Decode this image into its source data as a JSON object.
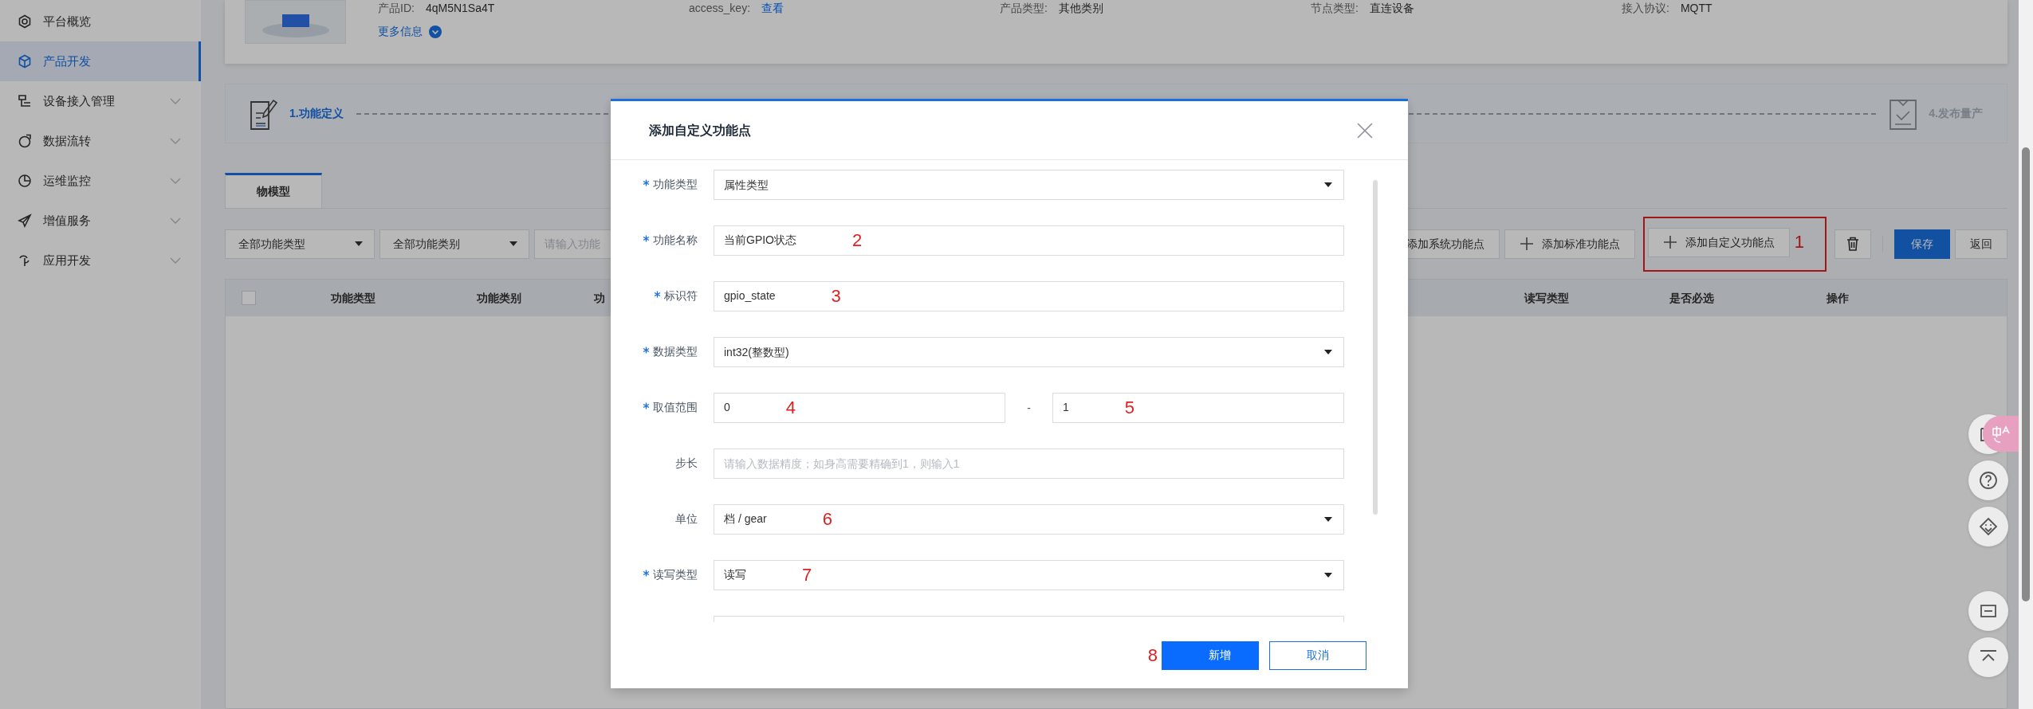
{
  "sidebar": {
    "items": [
      {
        "label": "平台概览",
        "selected": false,
        "expandable": false
      },
      {
        "label": "产品开发",
        "selected": true,
        "expandable": false
      },
      {
        "label": "设备接入管理",
        "selected": false,
        "expandable": true
      },
      {
        "label": "数据流转",
        "selected": false,
        "expandable": true
      },
      {
        "label": "运维监控",
        "selected": false,
        "expandable": true
      },
      {
        "label": "增值服务",
        "selected": false,
        "expandable": true
      },
      {
        "label": "应用开发",
        "selected": false,
        "expandable": true
      }
    ]
  },
  "product": {
    "info": [
      {
        "label": "产品ID:",
        "value": "4qM5N1Sa4T",
        "kind": "text"
      },
      {
        "label": "access_key:",
        "value": "查看",
        "kind": "link"
      },
      {
        "label": "产品类型:",
        "value": "其他类别",
        "kind": "text"
      },
      {
        "label": "节点类型:",
        "value": "直连设备",
        "kind": "text"
      },
      {
        "label": "接入协议:",
        "value": "MQTT",
        "kind": "text"
      }
    ],
    "more_link": "更多信息"
  },
  "steps": [
    {
      "label": "1.功能定义",
      "active": true
    },
    {
      "label": "4.发布量产",
      "active": false
    }
  ],
  "tabs": [
    {
      "label": "物模型",
      "selected": true
    }
  ],
  "toolbar": {
    "filters": [
      {
        "value": "全部功能类型"
      },
      {
        "value": "全部功能类别"
      }
    ],
    "search": {
      "placeholder": "请输入功能"
    },
    "buttons": [
      {
        "label": "添加系统功能点",
        "kind": "text",
        "highlighted": false
      },
      {
        "label": "添加标准功能点",
        "kind": "add",
        "highlighted": false
      },
      {
        "label": "添加自定义功能点",
        "kind": "add",
        "highlighted": true,
        "annotation": "1"
      },
      {
        "kind": "delete",
        "highlighted": false
      },
      {
        "label": "保存",
        "kind": "primary",
        "highlighted": false
      },
      {
        "label": "返回",
        "kind": "default",
        "highlighted": false
      }
    ]
  },
  "table": {
    "header_checkbox": {
      "checked": false
    },
    "columns": [
      "功能类型",
      "功能类别",
      "功",
      "读写类型",
      "是否必选",
      "操作"
    ]
  },
  "modal": {
    "title": "添加自定义功能点",
    "fields": [
      {
        "label": "功能类型",
        "required": true,
        "kind": "select",
        "value": "属性类型"
      },
      {
        "label": "功能名称",
        "required": true,
        "kind": "input",
        "value": "当前GPIO状态",
        "annotation": "2"
      },
      {
        "label": "标识符",
        "required": true,
        "kind": "input",
        "value": "gpio_state",
        "annotation": "3"
      },
      {
        "label": "数据类型",
        "required": true,
        "kind": "select",
        "value": "int32(整数型)"
      },
      {
        "label": "取值范围",
        "required": true,
        "kind": "range",
        "min": "0",
        "min_annotation": "4",
        "separator": "-",
        "max": "1",
        "max_annotation": "5"
      },
      {
        "label": "步长",
        "required": false,
        "kind": "input",
        "placeholder": "请输入数据精度；如身高需要精确到1，则输入1"
      },
      {
        "label": "单位",
        "required": false,
        "kind": "select",
        "value": "档 / gear",
        "annotation": "6"
      },
      {
        "label": "读写类型",
        "required": true,
        "kind": "select",
        "value": "读写",
        "annotation": "7"
      },
      {
        "required": false,
        "kind": "input"
      }
    ],
    "buttons": [
      {
        "label": "新增",
        "kind": "primary",
        "annotation": "8"
      },
      {
        "label": "取消",
        "kind": "default"
      }
    ]
  }
}
